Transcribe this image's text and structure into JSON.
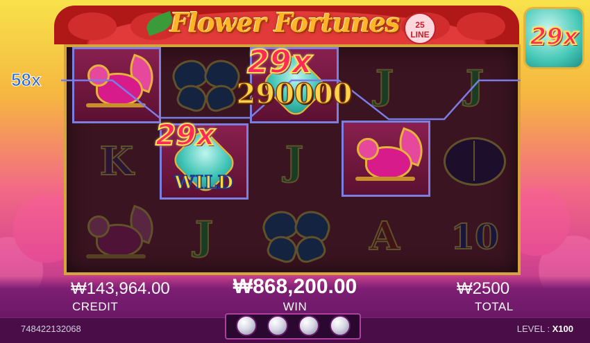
{
  "game": {
    "title": "Flower Fortunes",
    "lines_badge": "25 LINE"
  },
  "multipliers": {
    "side_left": "58x",
    "jade_tile": "29x",
    "reel_top": "29x",
    "reel_wild": "29x"
  },
  "big_win_amount": "290000",
  "wild_label": "WILD",
  "reels": [
    [
      "bird",
      "K",
      "bird"
    ],
    [
      "butterfly",
      "wild",
      "J"
    ],
    [
      "jade",
      "J",
      "butterfly"
    ],
    [
      "J",
      "bird",
      "A"
    ],
    [
      "J",
      "beetle",
      "10"
    ]
  ],
  "bottom": {
    "credit_value": "₩143,964.00",
    "credit_label": "CREDIT",
    "win_value": "₩868,200.00",
    "win_label": "WIN",
    "total_value": "₩2500",
    "total_label": "TOTAL",
    "account_id": "748422132068",
    "level_label": "LEVEL :",
    "level_value": "X100"
  },
  "colors": {
    "payline": "#7a7de8",
    "frame_gold": "#d4a53a",
    "multiplier_red": "#ff2a5a"
  }
}
